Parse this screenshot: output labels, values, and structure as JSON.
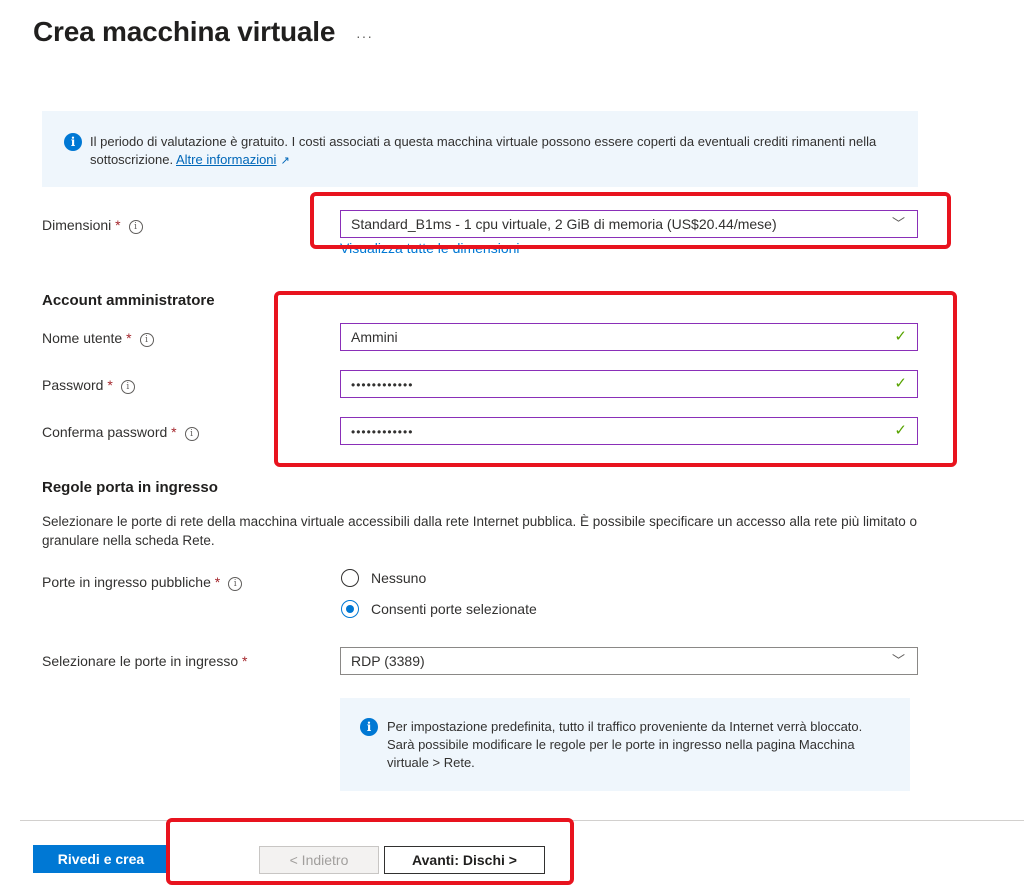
{
  "header": {
    "title": "Crea macchina virtuale",
    "more": "···"
  },
  "banner": {
    "icon": "info-icon",
    "text": "Il periodo di valutazione è gratuito. I costi associati a questa macchina virtuale possono essere coperti da eventuali crediti rimanenti nella sottoscrizione.",
    "link": "Altre informazioni",
    "link_icon": "external-link-icon"
  },
  "size": {
    "label": "Dimensioni",
    "value": "Standard_B1ms - 1 cpu virtuale, 2 GiB di memoria (US$20.44/mese)",
    "see_all": "Visualizza tutte le dimensioni"
  },
  "admin": {
    "section_title": "Account amministratore",
    "username_label": "Nome utente",
    "username_value": "Ammini",
    "password_label": "Password",
    "password_value": "••••••••••••",
    "confirm_label": "Conferma password",
    "confirm_value": "••••••••••••"
  },
  "ports": {
    "section_title": "Regole porta in ingresso",
    "description": "Selezionare le porte di rete della macchina virtuale accessibili dalla rete Internet pubblica. È possibile specificare un accesso alla rete più limitato o granulare nella scheda Rete.",
    "public_label": "Porte in ingresso pubbliche",
    "option_none": "Nessuno",
    "option_selected": "Consenti porte selezionate",
    "selected_option": "Consenti porte selezionate",
    "select_label": "Selezionare le porte in ingresso",
    "select_value": "RDP (3389)",
    "note": "Per impostazione predefinita, tutto il traffico proveniente da Internet verrà bloccato. Sarà possibile modificare le regole per le porte in ingresso nella pagina Macchina virtuale > Rete."
  },
  "footer": {
    "review_create": "Rivedi e crea",
    "back": "< Indietro",
    "next": "Avanti: Dischi >"
  },
  "common": {
    "required": "*",
    "tooltip": "i",
    "info": "i",
    "chevron": "﹀",
    "check": "✓"
  },
  "colors": {
    "accent": "#0078d4",
    "highlight": "#e8131e",
    "valid": "#57a300",
    "field_border": "#8a2fb8"
  }
}
